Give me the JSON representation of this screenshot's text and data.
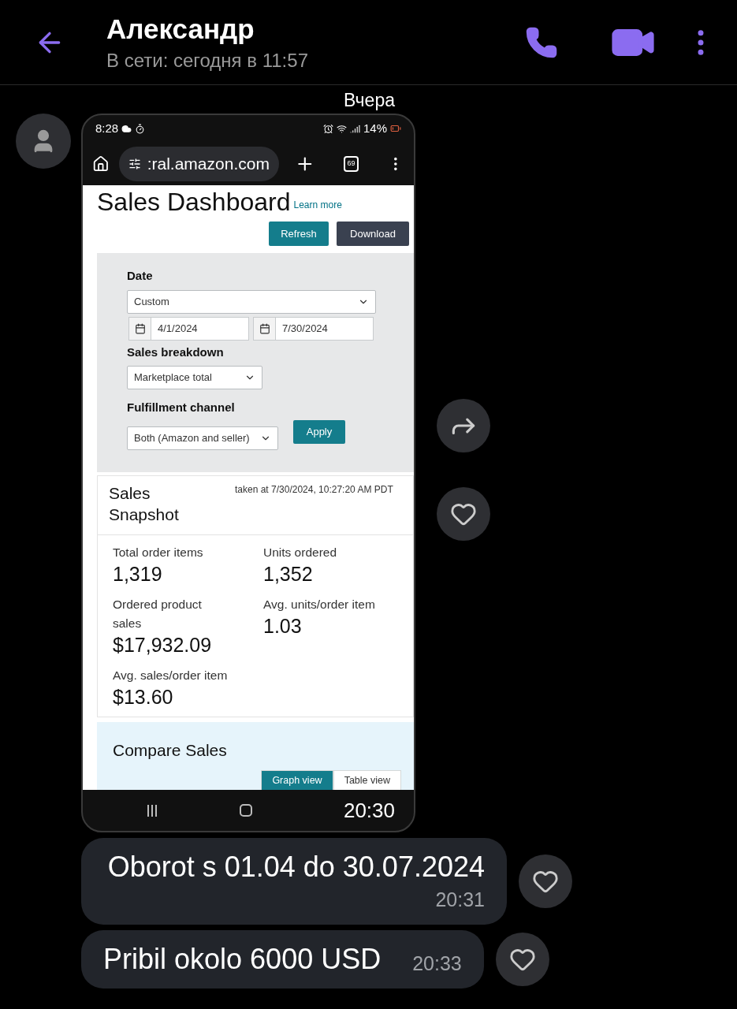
{
  "header": {
    "name": "Александр",
    "status": "В сети: сегодня в 11:57"
  },
  "date_separator": "Вчера",
  "image_message": {
    "status_bar": {
      "time": "8:28",
      "battery": "14%"
    },
    "browser": {
      "url": ":ral.amazon.com",
      "tab_count": "69"
    },
    "page": {
      "title": "Sales Dashboard",
      "learn_more": "Learn more",
      "buttons": [
        {
          "label": "Refresh",
          "kind": "primary"
        },
        {
          "label": "Download",
          "kind": "dark"
        }
      ],
      "filters": {
        "date_label": "Date",
        "date_select": "Custom",
        "start_date": "4/1/2024",
        "end_date": "7/30/2024",
        "breakdown_label": "Sales breakdown",
        "breakdown_select": "Marketplace total",
        "channel_label": "Fulfillment channel",
        "channel_select": "Both (Amazon and seller)",
        "apply": "Apply"
      },
      "snapshot": {
        "title": "Sales Snapshot",
        "taken_at": "taken at 7/30/2024, 10:27:20 AM PDT",
        "metrics": [
          {
            "label": "Total order items",
            "value": "1,319"
          },
          {
            "label": "Units ordered",
            "value": "1,352"
          },
          {
            "label": "Ordered product sales",
            "value": "$17,932.09"
          },
          {
            "label": "Avg. units/order item",
            "value": "1.03"
          },
          {
            "label": "Avg. sales/order item",
            "value": "$13.60"
          }
        ]
      },
      "compare": {
        "title": "Compare Sales",
        "views": [
          {
            "label": "Graph view",
            "selected": true
          },
          {
            "label": "Table view",
            "selected": false
          }
        ]
      }
    },
    "time": "20:30"
  },
  "messages": [
    {
      "text": "Oborot s 01.04 do 30.07.2024",
      "time": "20:31"
    },
    {
      "text": "Pribil okolo 6000 USD",
      "time": "20:33"
    }
  ]
}
